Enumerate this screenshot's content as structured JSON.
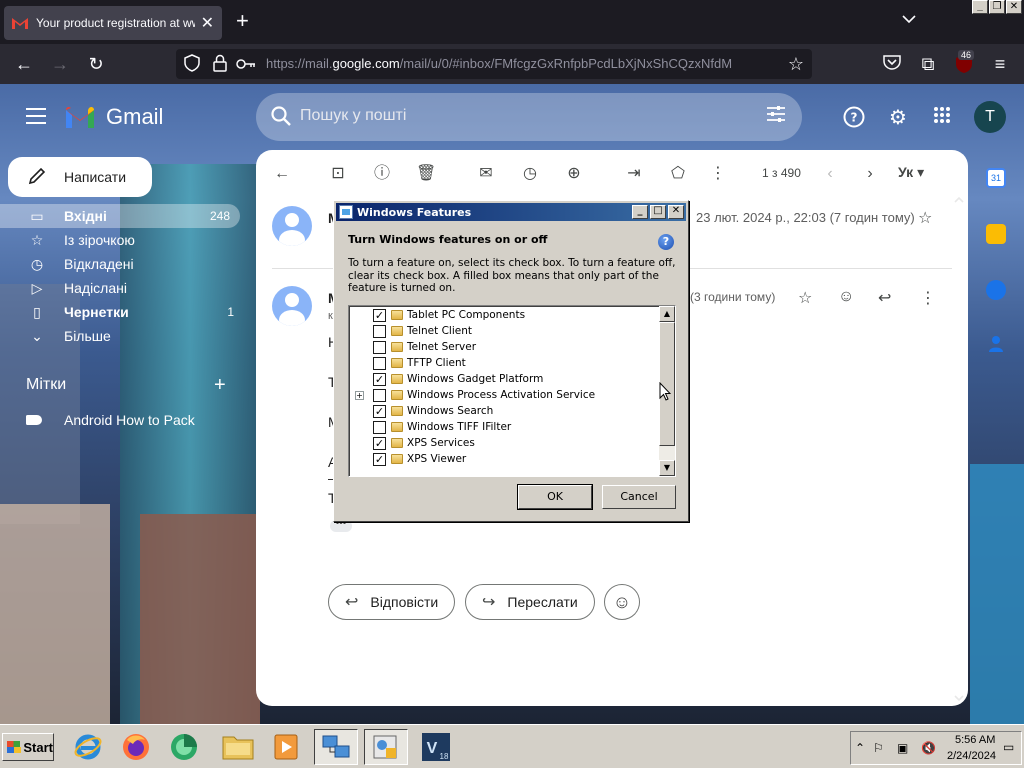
{
  "browser": {
    "tab_title": "Your product registration at www.",
    "url_host_prefix": "https://mail.",
    "url_host": "google.com",
    "url_path": "/mail/u/0/#inbox/FMfcgzGxRnfpbPcdLbXjNxShCQzxNfdM",
    "extension_badge": "46"
  },
  "gmail": {
    "brand": "Gmail",
    "search_placeholder": "Пошук у пошті",
    "avatar_letter": "T",
    "compose_label": "Написати",
    "nav": [
      {
        "label": "Вхідні",
        "count": "248",
        "icon": "inbox-icon"
      },
      {
        "label": "Із зірочкою",
        "count": "",
        "icon": "star-icon"
      },
      {
        "label": "Відкладені",
        "count": "",
        "icon": "clock-icon"
      },
      {
        "label": "Надіслані",
        "count": "",
        "icon": "send-icon"
      },
      {
        "label": "Чернетки",
        "count": "1",
        "icon": "draft-icon"
      },
      {
        "label": "Більше",
        "count": "",
        "icon": "chevron-down-icon"
      }
    ],
    "labels_title": "Мітки",
    "label_items": [
      "Android How to Pack"
    ],
    "toolbar_count": "1 з 490",
    "toolbar_lang": "Ук",
    "message1": {
      "sender": "M",
      "date": "23 лют. 2024 р., 22:03 (7 годин тому)"
    },
    "message2": {
      "sender": "M",
      "date": "(3 години тому)",
      "sub": "к"
    },
    "body_letters": [
      "Н",
      "Т",
      "М",
      "А",
      "–",
      "Т"
    ],
    "reply_label": "Відповісти",
    "forward_label": "Переслати"
  },
  "dialog": {
    "title": "Windows Features",
    "heading": "Turn Windows features on or off",
    "description": "To turn a feature on, select its check box. To turn a feature off, clear its check box. A filled box means that only part of the feature is turned on.",
    "help_glyph": "?",
    "features": [
      {
        "label": "Tablet PC Components",
        "checked": true,
        "expandable": false
      },
      {
        "label": "Telnet Client",
        "checked": false,
        "expandable": false
      },
      {
        "label": "Telnet Server",
        "checked": false,
        "expandable": false
      },
      {
        "label": "TFTP Client",
        "checked": false,
        "expandable": false
      },
      {
        "label": "Windows Gadget Platform",
        "checked": true,
        "expandable": false
      },
      {
        "label": "Windows Process Activation Service",
        "checked": false,
        "expandable": true
      },
      {
        "label": "Windows Search",
        "checked": true,
        "expandable": false
      },
      {
        "label": "Windows TIFF IFilter",
        "checked": false,
        "expandable": false
      },
      {
        "label": "XPS Services",
        "checked": true,
        "expandable": false
      },
      {
        "label": "XPS Viewer",
        "checked": true,
        "expandable": false
      }
    ],
    "ok_label": "OK",
    "cancel_label": "Cancel"
  },
  "taskbar": {
    "start_label": "Start",
    "apps": [
      "internet-explorer-icon",
      "firefox-icon",
      "media-icon",
      "folder-icon",
      "media-player-icon",
      "network-icon",
      "control-panel-icon",
      "v18-icon"
    ],
    "v18_label": "V",
    "v18_sub": "18",
    "time": "5:56 AM",
    "date": "2/24/2024"
  },
  "colors": {
    "gmail_red": "#ea4335",
    "title_bar": "#0a246a",
    "win_face": "#d4d0c8"
  }
}
